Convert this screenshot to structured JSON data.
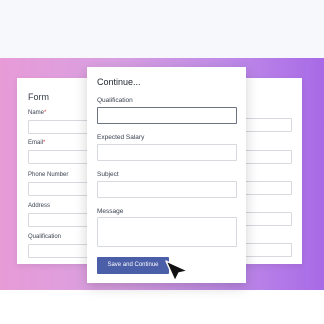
{
  "background_form": {
    "title": "Form",
    "fields": [
      {
        "label": "Name",
        "required": true
      },
      {
        "label": "Email",
        "required": true
      },
      {
        "label": "Phone Number",
        "required": false
      },
      {
        "label": "Address",
        "required": false
      },
      {
        "label": "Qualification",
        "required": false
      }
    ],
    "required_marker": "*"
  },
  "modal": {
    "title": "Continue...",
    "fields": [
      {
        "label": "Qualification",
        "value": "",
        "focused": true
      },
      {
        "label": "Expected Salary",
        "value": ""
      },
      {
        "label": "Subject",
        "value": ""
      },
      {
        "label": "Message",
        "value": ""
      }
    ],
    "submit_label": "Save and Continue"
  },
  "colors": {
    "gradient_left": "#e79bd7",
    "gradient_right": "#a86ae6",
    "button": "#4b5ea8",
    "required": "#d9333f"
  },
  "icons": {
    "cursor": "pointer-arrow-icon"
  }
}
